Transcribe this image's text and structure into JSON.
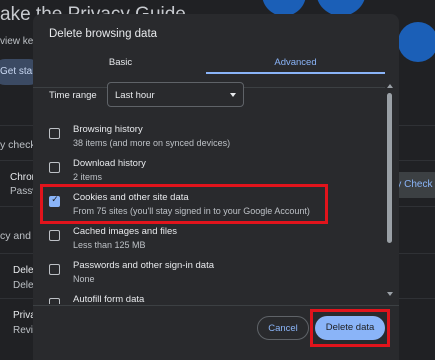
{
  "background": {
    "title": "ake the Privacy Guide",
    "subtitle": "view key",
    "get_started": "Get start",
    "safety_check_heading": "y check",
    "chrome_row_title": "Chron",
    "chrome_row_sub": "Passw",
    "safety_check_button": "ety Check",
    "privacy_security_heading": "cy and s",
    "delete_row_title": "Dele",
    "delete_row_sub": "Dele",
    "privacy_row_title": "Priva",
    "privacy_row_sub": "Revie"
  },
  "dialog": {
    "title": "Delete browsing data",
    "tabs": [
      {
        "label": "Basic",
        "selected": false
      },
      {
        "label": "Advanced",
        "selected": true
      }
    ],
    "time_range": {
      "label": "Time range",
      "value": "Last hour"
    },
    "items": [
      {
        "title": "Browsing history",
        "subtitle": "38 items (and more on synced devices)",
        "checked": false
      },
      {
        "title": "Download history",
        "subtitle": "2 items",
        "checked": false
      },
      {
        "title": "Cookies and other site data",
        "subtitle": "From 75 sites (you'll stay signed in to your Google Account)",
        "checked": true
      },
      {
        "title": "Cached images and files",
        "subtitle": "Less than 125 MB",
        "checked": false
      },
      {
        "title": "Passwords and other sign-in data",
        "subtitle": "None",
        "checked": false
      },
      {
        "title": "Autofill form data",
        "subtitle": "",
        "checked": false
      }
    ],
    "cancel_label": "Cancel",
    "delete_label": "Delete data"
  },
  "colors": {
    "accent": "#8ab4f8",
    "dialog_bg": "#292a2d",
    "page_bg": "#202124",
    "highlight": "#e1141c"
  },
  "icons": {
    "checkbox_checked": "check-icon",
    "dropdown": "chevron-down-icon"
  }
}
